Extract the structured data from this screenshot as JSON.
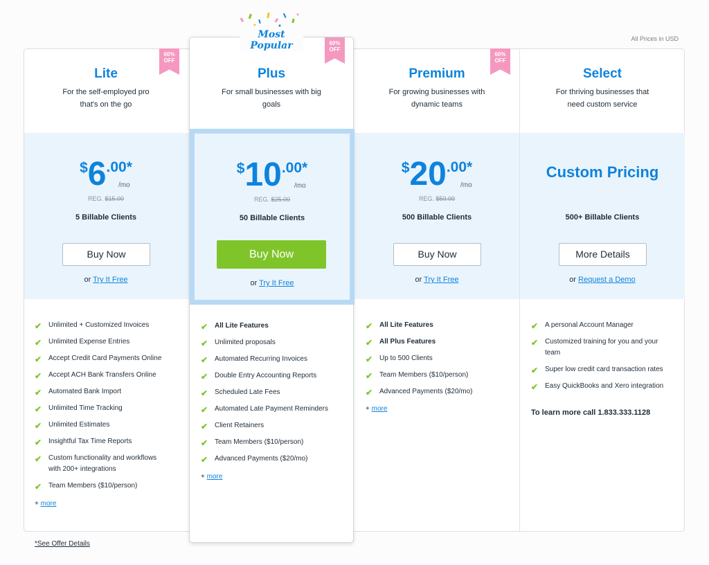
{
  "top_note": "All Prices in USD",
  "most_popular": "Most Popular",
  "offer_link": "*See Offer Details",
  "colors": {
    "accent": "#0d83dd",
    "buy_green": "#7fc52a",
    "band": "#eaf4fd",
    "ribbon": "#f598bf"
  },
  "plans": [
    {
      "name": "Lite",
      "desc": [
        "For the self-employed pro",
        "that's on the go"
      ],
      "ribbon": [
        "60%",
        "OFF"
      ],
      "currency": "$",
      "amount": "6",
      "cents": ".00*",
      "per": "/mo",
      "reg_label": "REG.",
      "reg_price": "$15.00",
      "clients": "5 Billable Clients",
      "button": "Buy Now",
      "try_prefix": "or",
      "try_link": "Try It Free",
      "features": [
        {
          "text": "Unlimited + Customized Invoices"
        },
        {
          "text": "Unlimited Expense Entries"
        },
        {
          "text": "Accept Credit Card Payments Online"
        },
        {
          "text": "Accept ACH Bank Transfers Online"
        },
        {
          "text": "Automated Bank Import"
        },
        {
          "text": "Unlimited Time Tracking"
        },
        {
          "text": "Unlimited Estimates"
        },
        {
          "text": "Insightful Tax Time Reports"
        },
        {
          "text": "Custom functionality and workflows with 200+ integrations"
        },
        {
          "text": "Team Members ($10/person)"
        }
      ],
      "more_prefix": "+",
      "more_link": "more"
    },
    {
      "name": "Plus",
      "desc": [
        "For small businesses with big",
        "goals"
      ],
      "ribbon": [
        "60%",
        "OFF"
      ],
      "currency": "$",
      "amount": "10",
      "cents": ".00*",
      "per": "/mo",
      "reg_label": "REG.",
      "reg_price": "$25.00",
      "clients": "50 Billable Clients",
      "button": "Buy Now",
      "try_prefix": "or",
      "try_link": "Try It Free",
      "features": [
        {
          "text": "All Lite Features"
        },
        {
          "text": "Unlimited proposals"
        },
        {
          "text": "Automated Recurring Invoices"
        },
        {
          "text": "Double Entry Accounting Reports"
        },
        {
          "text": "Scheduled Late Fees"
        },
        {
          "text": "Automated Late Payment Reminders"
        },
        {
          "text": "Client Retainers"
        },
        {
          "text": "Team Members ($10/person)"
        },
        {
          "text": "Advanced Payments ($20/mo)"
        }
      ],
      "more_prefix": "+",
      "more_link": "more"
    },
    {
      "name": "Premium",
      "desc": [
        "For growing businesses with",
        "dynamic teams"
      ],
      "ribbon": [
        "60%",
        "OFF"
      ],
      "currency": "$",
      "amount": "20",
      "cents": ".00*",
      "per": "/mo",
      "reg_label": "REG.",
      "reg_price": "$50.00",
      "clients": "500 Billable Clients",
      "button": "Buy Now",
      "try_prefix": "or",
      "try_link": "Try It Free",
      "features": [
        {
          "text": "All Lite Features"
        },
        {
          "text": "All Plus Features"
        },
        {
          "text": "Up to 500 Clients"
        },
        {
          "text": "Team Members ($10/person)"
        },
        {
          "text": "Advanced Payments ($20/mo)"
        }
      ],
      "more_prefix": "+",
      "more_link": "more"
    },
    {
      "name": "Select",
      "desc": [
        "For thriving businesses that",
        "need custom service"
      ],
      "custom_pricing": "Custom Pricing",
      "clients": "500+ Billable Clients",
      "button": "More Details",
      "try_prefix": "or",
      "try_link": "Request a Demo",
      "features": [
        {
          "text": "A personal Account Manager"
        },
        {
          "text": "Customized training for you and your team"
        },
        {
          "text": "Super low credit card transaction rates"
        },
        {
          "text": "Easy QuickBooks and Xero integration"
        }
      ],
      "call_text": "To learn more call 1.833.333.1128"
    }
  ]
}
